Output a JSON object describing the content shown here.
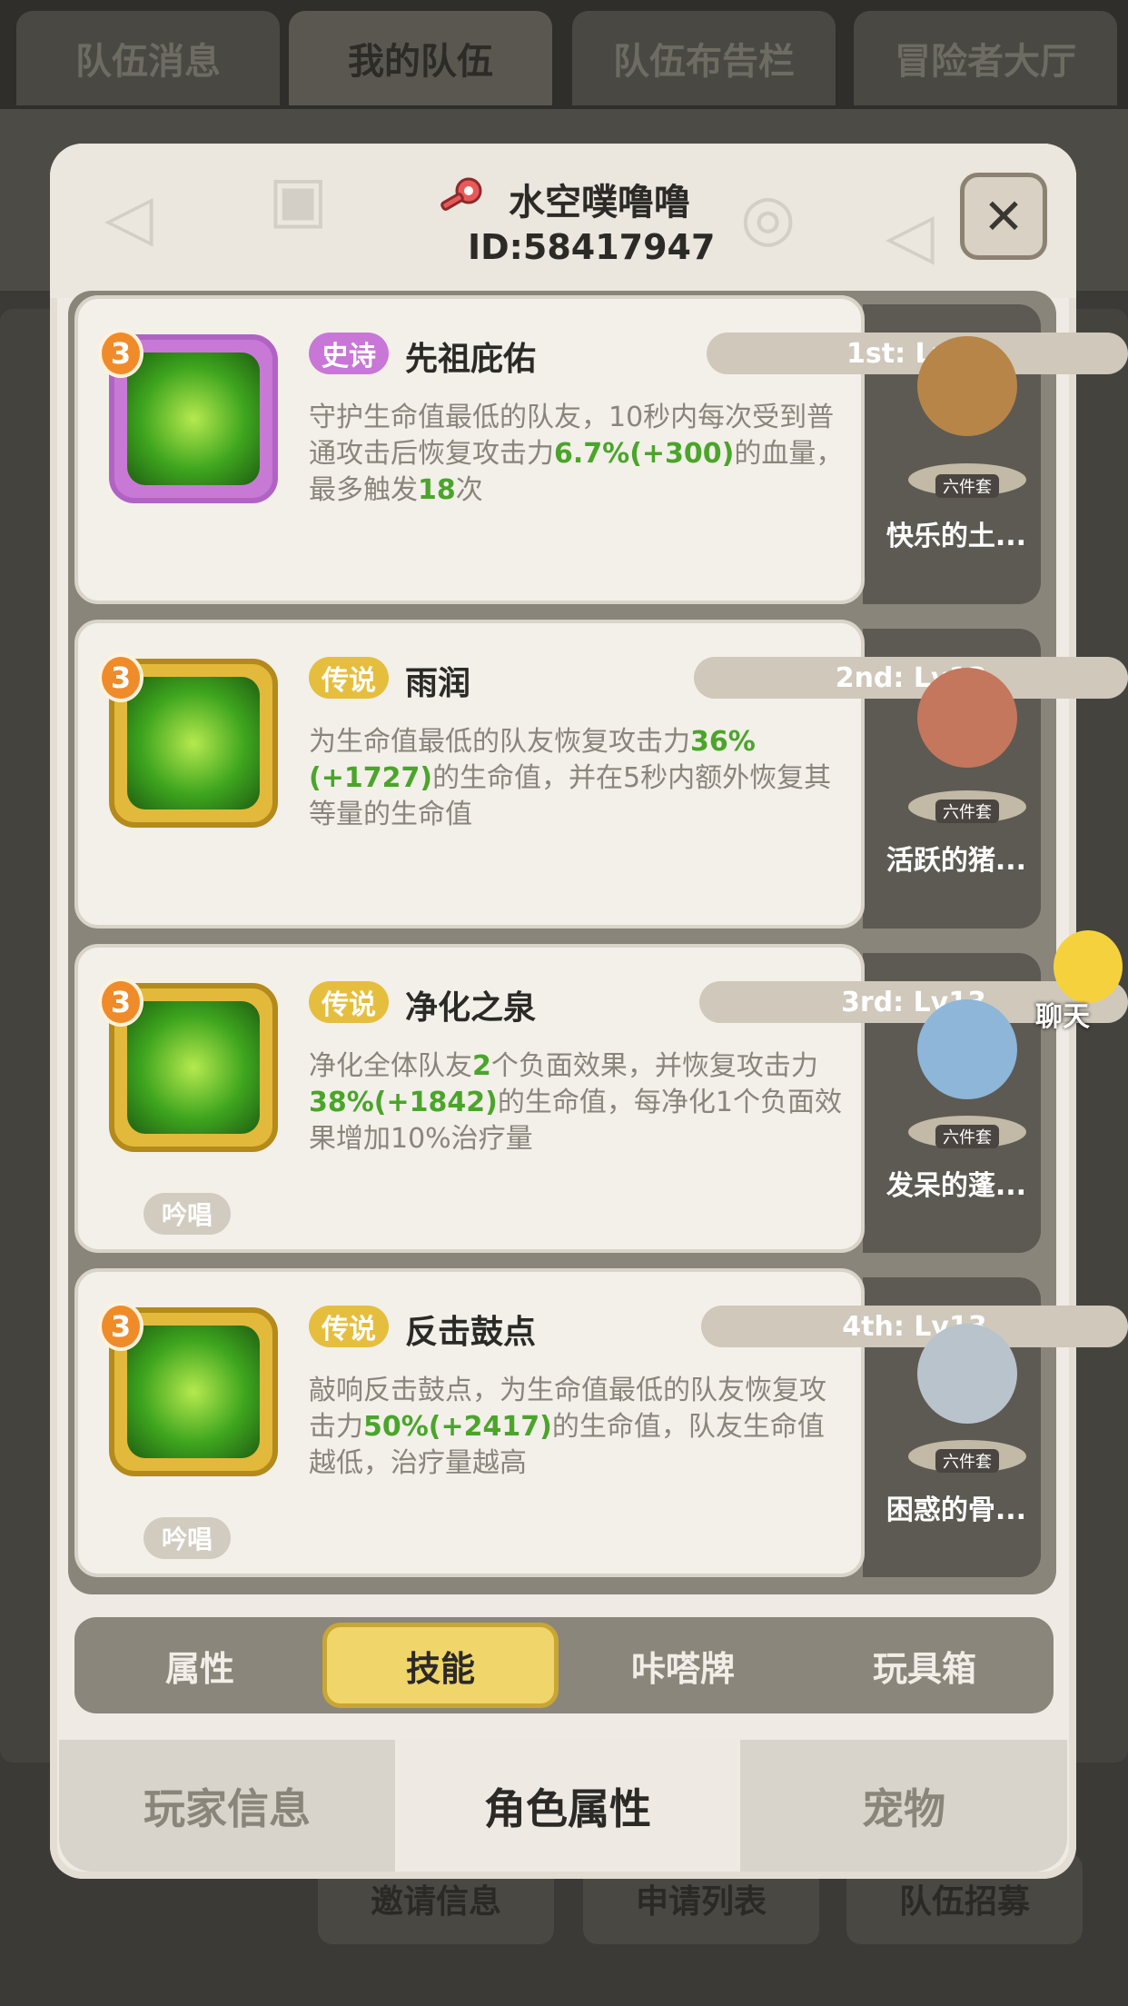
{
  "top_tabs": [
    "队伍消息",
    "我的队伍",
    "队伍布告栏",
    "冒险者大厅"
  ],
  "bottom_bg_buttons": [
    "邀请信息",
    "申请列表",
    "队伍招募"
  ],
  "player": {
    "name": "水空噗噜噜",
    "id": "ID:58417947"
  },
  "skills": [
    {
      "level": "3",
      "rarity": "史诗",
      "rarity_type": "epic",
      "name": "先祖庇佑",
      "slot": "1st: Lv13",
      "desc": [
        "守护生命值最低的队友，10秒内每次受到普通攻击后恢复攻击力",
        "6.7%(+300)",
        "的血量，最多触发",
        "18",
        "次"
      ],
      "chant": "",
      "pet_tag": "六件套",
      "pet_name": "快乐的土..."
    },
    {
      "level": "3",
      "rarity": "传说",
      "rarity_type": "leg",
      "name": "雨润",
      "slot": "2nd: Lv13",
      "desc": [
        "为生命值最低的队友恢复攻击力",
        "36%(+1727)",
        "的生命值，并在5秒内额外恢复其等量的生命值",
        "",
        ""
      ],
      "chant": "",
      "pet_tag": "六件套",
      "pet_name": "活跃的猪..."
    },
    {
      "level": "3",
      "rarity": "传说",
      "rarity_type": "leg",
      "name": "净化之泉",
      "slot": "3rd: Lv13",
      "desc": [
        "净化全体队友",
        "2",
        "个负面效果，并恢复攻击力",
        "38%(+1842)",
        "的生命值，每净化1个负面效果增加10%治疗量"
      ],
      "chant": "吟唱",
      "pet_tag": "六件套",
      "pet_name": "发呆的蓬..."
    },
    {
      "level": "3",
      "rarity": "传说",
      "rarity_type": "leg",
      "name": "反击鼓点",
      "slot": "4th: Lv13",
      "desc": [
        "敲响反击鼓点，为生命值最低的队友恢复攻击力",
        "50%(+2417)",
        "的生命值，队友生命值越低，治疗量越高",
        "",
        ""
      ],
      "chant": "吟唱",
      "pet_tag": "六件套",
      "pet_name": "困惑的骨..."
    }
  ],
  "skill_tabs": [
    "属性",
    "技能",
    "咔嗒牌",
    "玩具箱"
  ],
  "bottom_tabs": [
    "玩家信息",
    "角色属性",
    "宠物"
  ],
  "chat_label": "聊天",
  "close_glyph": "✕"
}
